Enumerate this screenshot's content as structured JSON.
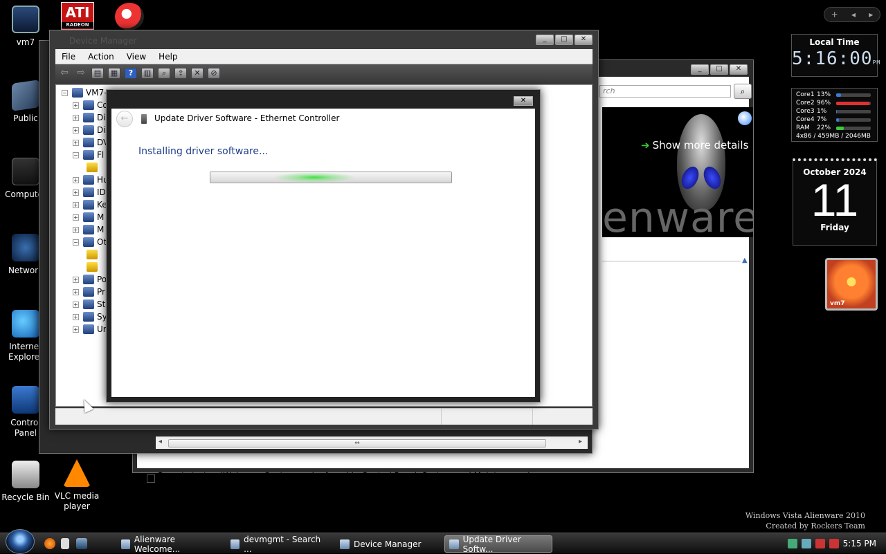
{
  "desktop": {
    "icons": [
      {
        "label": "vm7"
      },
      {
        "label": "Public"
      },
      {
        "label": "Computer"
      },
      {
        "label": "Network"
      },
      {
        "label": "Internet Explorer"
      },
      {
        "label": "Control Panel"
      },
      {
        "label": "Recycle Bin"
      },
      {
        "label": "VLC media player"
      }
    ],
    "ati_text": "ATI",
    "ati_sub": "RADEON",
    "watermark_line1": "Windows Vista Alienware 2010",
    "watermark_line2": "Created by Rockers Team"
  },
  "welcome_window": {
    "search_placeholder": "rch",
    "show_more": "Show more details",
    "brand_text": "enware",
    "startup_label": "Run at startup (Welcome Center can be found in Control Panel, System and Maintenance)",
    "startup_checked": true
  },
  "device_manager": {
    "title": "Device Manager",
    "menu": [
      "File",
      "Action",
      "View",
      "Help"
    ],
    "root_label": "VM7-",
    "nodes": [
      "Co",
      "Di",
      "Di",
      "DV",
      "Fl",
      "",
      "Hu",
      "ID",
      "Ke",
      "M",
      "M",
      "Ot",
      "",
      "",
      "Po",
      "Pr",
      "St",
      "Sy",
      "Ur"
    ]
  },
  "update_dialog": {
    "title": "Update Driver Software - Ethernet Controller",
    "heading": "Installing driver software...",
    "close_glyph": "✕"
  },
  "gadgets": {
    "clock_label": "Local Time",
    "clock_time": "5:16:00",
    "clock_ampm": "PM",
    "cpu": [
      {
        "name": "Core1",
        "pct": "13%",
        "value": 13,
        "color": "#3a7bd5"
      },
      {
        "name": "Core2",
        "pct": "96%",
        "value": 96,
        "color": "#e03030"
      },
      {
        "name": "Core3",
        "pct": "1%",
        "value": 1,
        "color": "#3a7bd5"
      },
      {
        "name": "Core4",
        "pct": "7%",
        "value": 7,
        "color": "#3a7bd5"
      },
      {
        "name": "RAM",
        "pct": "22%",
        "value": 22,
        "color": "#3cc83c"
      }
    ],
    "cpu_extra": "4x86 / 459MB / 2046MB",
    "cal_month": "October 2024",
    "cal_day": "11",
    "cal_weekday": "Friday",
    "photo_label": "vm7"
  },
  "taskbar": {
    "tasks": [
      {
        "label": "Alienware Welcome..."
      },
      {
        "label": "devmgmt - Search ..."
      },
      {
        "label": "Device Manager"
      },
      {
        "label": "Update Driver Softw..."
      }
    ],
    "clock": "5:15 PM"
  }
}
